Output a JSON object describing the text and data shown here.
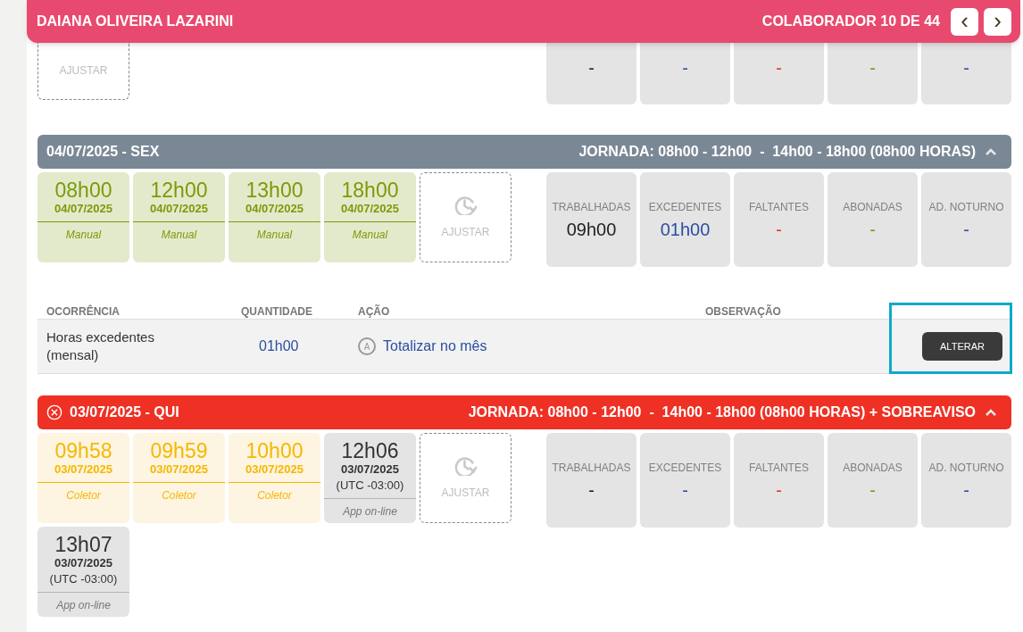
{
  "header": {
    "name": "DAIANA OLIVEIRA LAZARINI",
    "counter": "COLABORADOR 10 DE 44",
    "prev": "‹",
    "next": "›"
  },
  "top_section": {
    "adjust_label": "AJUSTAR",
    "stats": [
      {
        "value": "-",
        "kind": "worked"
      },
      {
        "value": "-",
        "kind": "extra"
      },
      {
        "value": "-",
        "kind": "missing"
      },
      {
        "value": "-",
        "kind": "excused"
      },
      {
        "value": "-",
        "kind": "night"
      }
    ]
  },
  "days": [
    {
      "date": "04/07/2025 - SEX",
      "error": false,
      "jornada": "JORNADA: 08h00 - 12h00  -  14h00 - 18h00 (08h00 HORAS)",
      "expanded": true,
      "punches": [
        {
          "time": "08h00",
          "date": "04/07/2025",
          "source": "Manual",
          "kind": "manual"
        },
        {
          "time": "12h00",
          "date": "04/07/2025",
          "source": "Manual",
          "kind": "manual"
        },
        {
          "time": "13h00",
          "date": "04/07/2025",
          "source": "Manual",
          "kind": "manual"
        },
        {
          "time": "18h00",
          "date": "04/07/2025",
          "source": "Manual",
          "kind": "manual"
        }
      ],
      "adjust_label": "AJUSTAR",
      "stats": [
        {
          "label": "TRABALHADAS",
          "value": "09h00",
          "kind": "worked"
        },
        {
          "label": "EXCEDENTES",
          "value": "01h00",
          "kind": "extra"
        },
        {
          "label": "FALTANTES",
          "value": "-",
          "kind": "missing"
        },
        {
          "label": "ABONADAS",
          "value": "-",
          "kind": "excused"
        },
        {
          "label": "AD. NOTURNO",
          "value": "-",
          "kind": "night"
        }
      ],
      "occurrences": {
        "columns": [
          "OCORRÊNCIA",
          "QUANTIDADE",
          "AÇÃO",
          "OBSERVAÇÃO"
        ],
        "rows": [
          {
            "occurrence": "Horas excedentes (mensal)",
            "quantity": "01h00",
            "action_badge": "A",
            "action": "Totalizar no mês",
            "button": "ALTERAR",
            "highlighted": true
          }
        ]
      }
    },
    {
      "date": "03/07/2025 - QUI",
      "error": true,
      "jornada": "JORNADA: 08h00 - 12h00  -  14h00 - 18h00 (08h00 HORAS) + SOBREAVISO",
      "expanded": true,
      "punches": [
        {
          "time": "09h58",
          "date": "03/07/2025",
          "source": "Coletor",
          "kind": "collector"
        },
        {
          "time": "09h59",
          "date": "03/07/2025",
          "source": "Coletor",
          "kind": "collector"
        },
        {
          "time": "10h00",
          "date": "03/07/2025",
          "source": "Coletor",
          "kind": "collector"
        },
        {
          "time": "12h06",
          "date": "03/07/2025",
          "utc": "(UTC -03:00)",
          "source": "App on-line",
          "kind": "app"
        },
        {
          "time": "13h07",
          "date": "03/07/2025",
          "utc": "(UTC -03:00)",
          "source": "App on-line",
          "kind": "app"
        }
      ],
      "adjust_label": "AJUSTAR",
      "stats": [
        {
          "label": "TRABALHADAS",
          "value": "-",
          "kind": "worked"
        },
        {
          "label": "EXCEDENTES",
          "value": "-",
          "kind": "extra"
        },
        {
          "label": "FALTANTES",
          "value": "-",
          "kind": "missing"
        },
        {
          "label": "ABONADAS",
          "value": "-",
          "kind": "excused"
        },
        {
          "label": "AD. NOTURNO",
          "value": "-",
          "kind": "night"
        }
      ]
    }
  ]
}
